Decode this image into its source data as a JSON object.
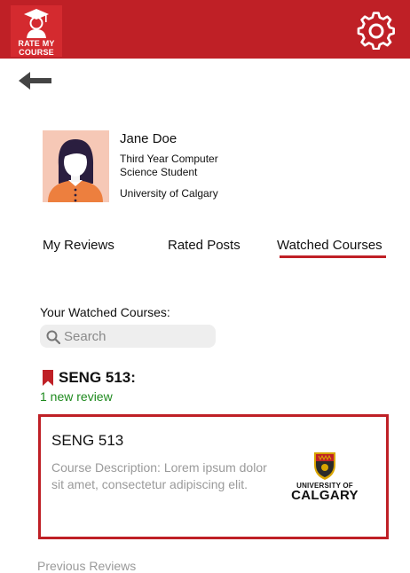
{
  "header": {
    "logo_text_line1": "RATE MY",
    "logo_text_line2": "COURSE",
    "bg_color": "#bf2026",
    "settings_icon": "gear-icon",
    "back_icon": "arrow-left-icon"
  },
  "profile": {
    "name": "Jane Doe",
    "role": "Third Year Computer Science Student",
    "school": "University of Calgary",
    "avatar_icon": "user-avatar"
  },
  "tabs": [
    {
      "label": "My Reviews",
      "active": false
    },
    {
      "label": "Rated Posts",
      "active": false
    },
    {
      "label": "Watched Courses",
      "active": true
    }
  ],
  "watched": {
    "title": "Your Watched Courses:",
    "search_placeholder": "Search"
  },
  "course": {
    "code": "SENG 513:",
    "new_reviews": "1 new review",
    "bookmark_icon": "bookmark-icon",
    "card_title": "SENG 513",
    "card_description": "Course Description: Lorem ipsum dolor sit amet, consectetur adipiscing elit.",
    "logo_line1": "UNIVERSITY OF",
    "logo_line2": "CALGARY"
  },
  "previous_reviews_label": "Previous Reviews",
  "colors": {
    "accent": "#bf2026",
    "green": "#1e8a1e",
    "muted": "#9a9a9a"
  }
}
